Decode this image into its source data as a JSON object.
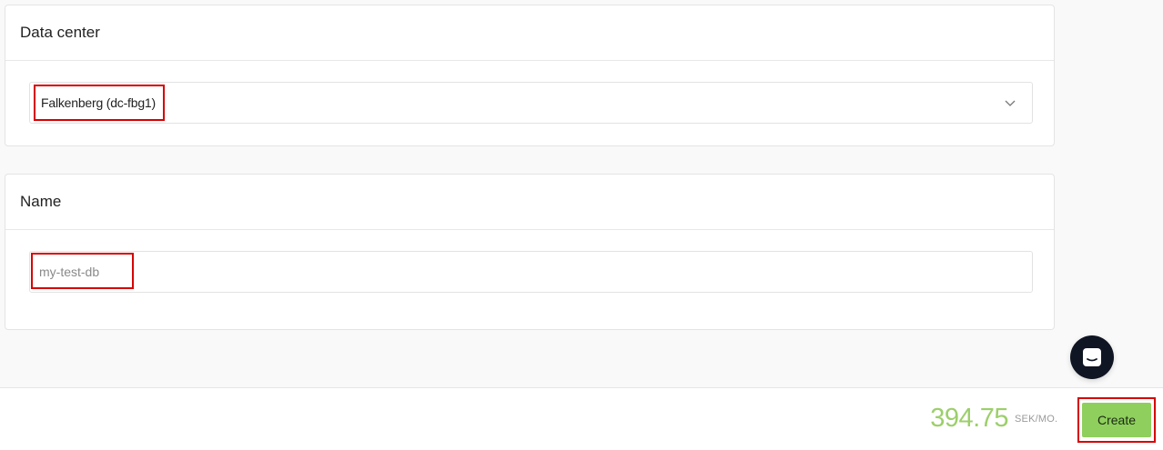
{
  "data_center": {
    "header": "Data center",
    "selected": "Falkenberg (dc-fbg1)"
  },
  "name_section": {
    "header": "Name",
    "placeholder": "my-test-db",
    "value": ""
  },
  "footer": {
    "price": "394.75",
    "price_unit": "SEK/MO.",
    "create_label": "Create"
  },
  "icons": {
    "select_chevron": "chevron-down-icon",
    "chat": "chat-icon"
  },
  "colors": {
    "price": "#9ccf6a",
    "create_button": "#8fcf5e",
    "highlight": "#d60000",
    "chat_button": "#0f1522"
  }
}
